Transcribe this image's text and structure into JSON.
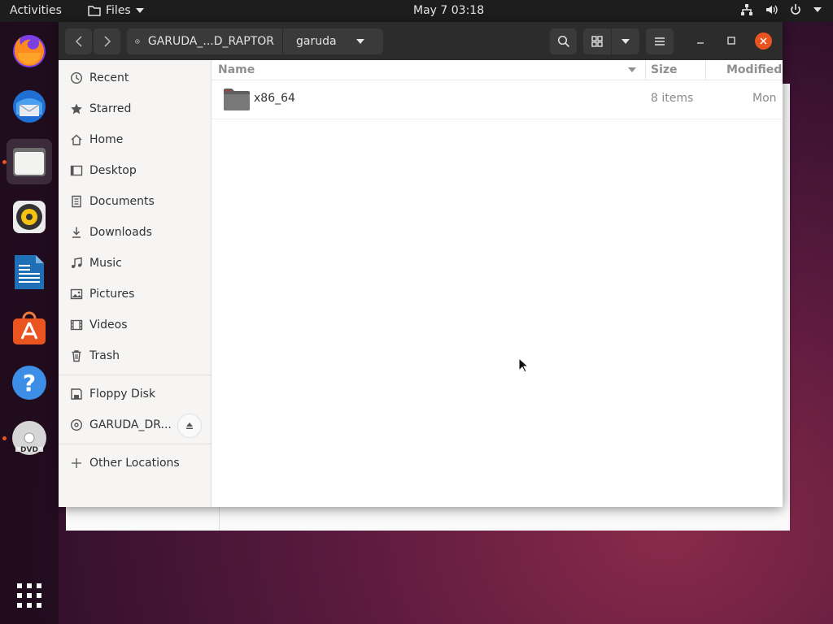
{
  "topbar": {
    "activities": "Activities",
    "app_menu": "Files",
    "clock": "May 7  03:18"
  },
  "dock": {
    "items": [
      "firefox-icon",
      "thunderbird-icon",
      "files-icon",
      "rhythmbox-icon",
      "libreoffice-writer-icon",
      "software-center-icon",
      "help-icon",
      "dvd-icon",
      "show-apps-icon"
    ]
  },
  "headerbar": {
    "path_root": "GARUDA_...D_RAPTOR",
    "path_current": "garuda"
  },
  "sidebar": {
    "items": [
      {
        "label": "Recent",
        "icon": "clock-icon"
      },
      {
        "label": "Starred",
        "icon": "star-icon"
      },
      {
        "label": "Home",
        "icon": "home-icon"
      },
      {
        "label": "Desktop",
        "icon": "desktop-icon"
      },
      {
        "label": "Documents",
        "icon": "document-icon"
      },
      {
        "label": "Downloads",
        "icon": "download-icon"
      },
      {
        "label": "Music",
        "icon": "music-icon"
      },
      {
        "label": "Pictures",
        "icon": "picture-icon"
      },
      {
        "label": "Videos",
        "icon": "video-icon"
      },
      {
        "label": "Trash",
        "icon": "trash-icon"
      }
    ],
    "devices": [
      {
        "label": "Floppy Disk",
        "icon": "floppy-icon"
      },
      {
        "label": "GARUDA_DR...",
        "icon": "disc-icon"
      }
    ],
    "other": {
      "label": "Other Locations",
      "icon": "plus-icon"
    }
  },
  "columns": {
    "name": "Name",
    "size": "Size",
    "modified": "Modified"
  },
  "files": [
    {
      "name": "x86_64",
      "size": "8 items",
      "modified": "Mon"
    }
  ]
}
